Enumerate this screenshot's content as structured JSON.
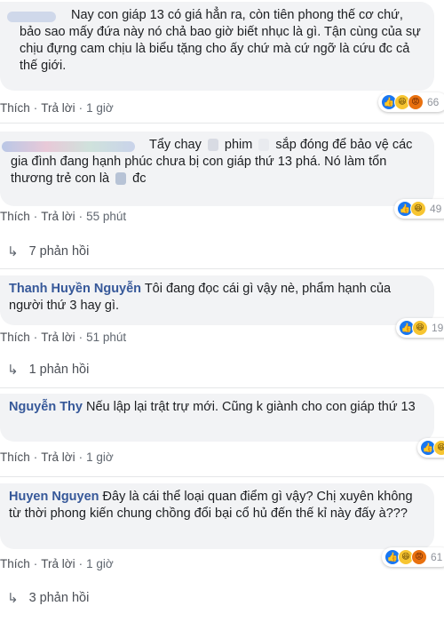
{
  "comments": [
    {
      "author": "",
      "text": "Nay con giáp 13 có giá hẳn ra, còn tiên phong thế cơ chứ, bảo sao mấy đứa này nó chả bao giờ biết nhục là gì. Tận cùng của sự chịu đựng cam chịu là biểu tặng cho ấy chứ mà cứ ngỡ là cứu đc cả thế giới.",
      "time": "1 giờ",
      "reaction_count": "66",
      "replies": ""
    },
    {
      "author": "",
      "text_part1": "Tẩy chay",
      "text_part2": "phim",
      "text_part3": "sắp đóng để bảo vệ các gia đình đang hạnh phúc chưa bị con giáp thứ 13 phá. Nó làm tổn thương trẻ con là",
      "text_part4": "đc",
      "time": "55 phút",
      "reaction_count": "49",
      "replies": "7 phản hồi"
    },
    {
      "author": "Thanh Huyền Nguyễn",
      "text": "Tôi đang đọc cái gì vậy nè, phẩm hạnh của người thứ 3 hay gì.",
      "time": "51 phút",
      "reaction_count": "19",
      "replies": "1 phản hồi"
    },
    {
      "author": "Nguyễn Thy",
      "text": "Nếu lập lại trật trự mới. Cũng k giành cho con giáp thứ 13",
      "time": "1 giờ",
      "reaction_count": "",
      "replies": ""
    },
    {
      "author": "Huyen Nguyen",
      "text": "Đây là cái thể loại quan điểm gì vậy? Chị xuyên không từ thời phong kiến chung chồng đổi bại cổ hủ đến thế kỉ này đấy à???",
      "time": "1 giờ",
      "reaction_count": "61",
      "replies": "3 phản hồi"
    }
  ],
  "actions": {
    "like": "Thích",
    "reply": "Trả lời",
    "dot": "·"
  },
  "icons": {
    "like": "like-icon",
    "haha": "haha-icon",
    "angry": "angry-icon",
    "reply_arrow": "reply-arrow-icon"
  },
  "colors": {
    "bubble": "#f2f3f5",
    "author": "#365899",
    "like": "#1877f2",
    "haha": "#f7c531"
  }
}
